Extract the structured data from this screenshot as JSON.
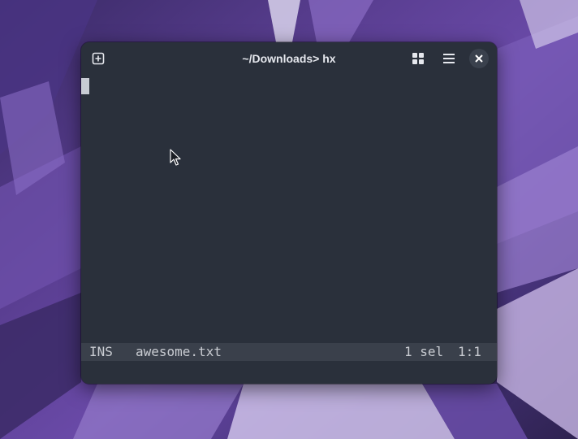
{
  "window": {
    "title": "~/Downloads> hx"
  },
  "titlebar_icons": {
    "new_tab": "new-tab-icon",
    "layout": "grid-icon",
    "menu": "hamburger-menu-icon",
    "close": "close-icon"
  },
  "statusline": {
    "mode": "INS",
    "filename": "awesome.txt",
    "selections": "1 sel",
    "position": "1:1"
  },
  "colors": {
    "window_bg": "#2a303b",
    "statusline_bg": "#3a404b",
    "text": "#c9ccd2",
    "cursor": "#c8ccd4"
  }
}
